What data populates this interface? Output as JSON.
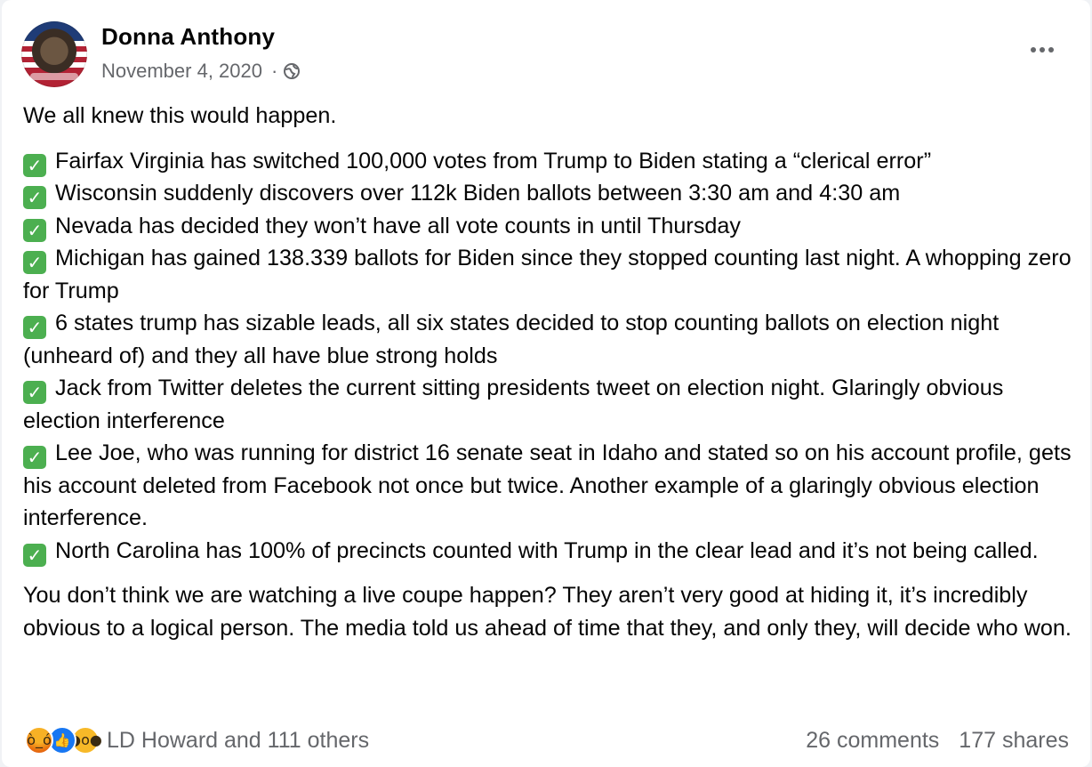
{
  "post": {
    "author": "Donna Anthony",
    "date": "November 4, 2020",
    "date_separator": "·",
    "privacy_icon": "globe-icon",
    "more_icon": "more-options-icon"
  },
  "content": {
    "intro": "We all knew this would happen.",
    "bullets": [
      {
        "icon": "check-mark-icon",
        "text": "Fairfax Virginia has switched 100,000 votes from Trump to Biden stating a “clerical error”"
      },
      {
        "icon": "check-mark-icon",
        "text": "Wisconsin suddenly discovers over 112k Biden ballots between 3:30 am and 4:30 am"
      },
      {
        "icon": "check-mark-icon",
        "text": "Nevada has decided they won’t have all vote counts in until Thursday"
      },
      {
        "icon": "check-mark-icon",
        "text": "Michigan has gained 138.339 ballots for Biden since they stopped counting last night. A whopping zero for Trump"
      },
      {
        "icon": "check-mark-icon",
        "text": "6 states trump has sizable leads, all six states decided to stop counting ballots on election night (unheard of) and they all have blue strong holds"
      },
      {
        "icon": "check-mark-icon",
        "text": "Jack from Twitter deletes the current sitting presidents tweet on election night. Glaringly obvious election interference"
      },
      {
        "icon": "check-mark-icon",
        "text": "Lee Joe, who was running for district 16 senate seat in Idaho and stated so on his account profile, gets his account deleted from Facebook not once but twice. Another example of a glaringly obvious election interference."
      },
      {
        "icon": "check-mark-icon",
        "text": "North Carolina has 100% of precincts counted with Trump in the clear lead and it’s not being called."
      }
    ],
    "closing": "You don’t think we are watching a live coupe happen? They aren’t very good at hiding it, it’s incredibly obvious to a logical person. The media told us ahead of time that they, and only they, will decide who won."
  },
  "footer": {
    "reactions": [
      "angry-reaction-icon",
      "like-reaction-icon",
      "wow-reaction-icon"
    ],
    "reactors": "LD Howard and 111 others",
    "comments": "26 comments",
    "shares": "177 shares"
  },
  "colors": {
    "background": "#f0f2f5",
    "card": "#ffffff",
    "text": "#050505",
    "secondary_text": "#65676b",
    "check": "#4caf50",
    "like": "#1877f2"
  }
}
